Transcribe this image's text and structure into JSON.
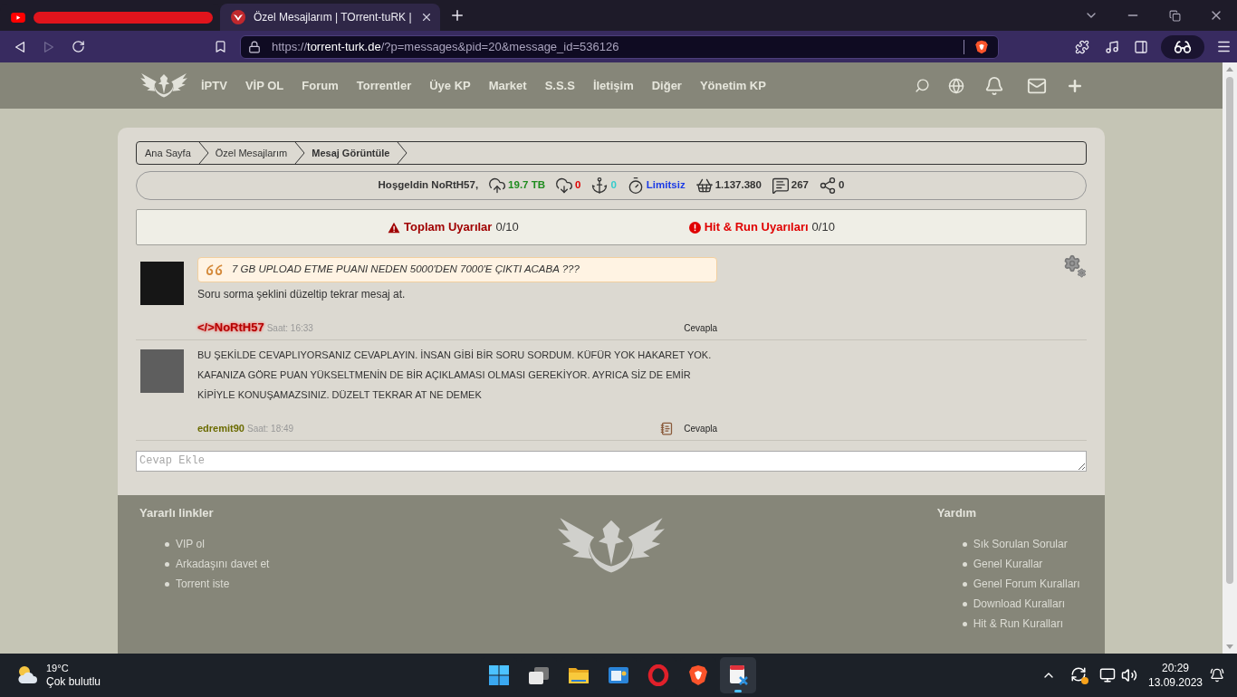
{
  "browser": {
    "tabs": [
      {
        "kind": "redacted",
        "selected": false
      },
      {
        "kind": "page",
        "title": "Özel Mesajlarım | TOrrent-tuRK |",
        "selected": true
      }
    ],
    "forward_button": {
      "disabled": true
    },
    "url": {
      "scheme": "https://",
      "host": "torrent-turk.de",
      "path": "/?p=messages&pid=20&message_id=536126"
    }
  },
  "nav": {
    "items": [
      "İPTV",
      "VİP OL",
      "Forum",
      "Torrentler",
      "Üye KP",
      "Market",
      "S.S.S",
      "İletişim",
      "Diğer",
      "Yönetim KP"
    ]
  },
  "breadcrumb": [
    {
      "label": "Ana Sayfa",
      "selected": false
    },
    {
      "label": "Özel Mesajlarım",
      "selected": false
    },
    {
      "label": "Mesaj Görüntüle",
      "selected": true
    }
  ],
  "stats": {
    "greeting": "Hoşgeldin NoRtH57,",
    "items": [
      {
        "kind": "upload",
        "value": "19.7 TB",
        "color": "#1e8c1e"
      },
      {
        "kind": "download",
        "value": "0",
        "color": "#e00000"
      },
      {
        "kind": "anchor",
        "value": "0",
        "color": "#33cccc"
      },
      {
        "kind": "timer",
        "value": "Limitsiz",
        "color": "#1a3ae6"
      },
      {
        "kind": "basket",
        "value": "1.137.380",
        "color": "#333333"
      },
      {
        "kind": "comments",
        "value": "267",
        "color": "#333333"
      },
      {
        "kind": "share",
        "value": "0",
        "color": "#333333"
      }
    ]
  },
  "warnings": [
    {
      "kind": "triangle",
      "label": "Toplam Uyarılar",
      "count": "0/10",
      "color": "#a00000"
    },
    {
      "kind": "circle",
      "label": "Hit & Run Uyarıları",
      "count": "0/10",
      "color": "#e00000"
    }
  ],
  "messages": [
    {
      "kind": "staff",
      "quote": "7 GB UPLOAD ETME PUANI NEDEN 5000'DEN 7000'E ÇIKTI ACABA ???",
      "lines": [
        "Soru sorma şeklini düzeltip tekrar mesaj at."
      ],
      "author": "</>NoRtH57",
      "time": "Saat: 16:33",
      "reply": "Cevapla"
    },
    {
      "kind": "member",
      "lines": [
        "BU ŞEKİLDE CEVAPLIYORSANIZ CEVAPLAYIN. İNSAN GİBİ BİR SORU SORDUM. KÜFÜR YOK HAKARET YOK.",
        "KAFANIZA GÖRE PUAN YÜKSELTMENİN DE BİR AÇIKLAMASI OLMASI GEREKİYOR. AYRICA SİZ DE EMİR",
        "KİPİYLE KONUŞAMAZSINIZ. DÜZELT TEKRAR AT NE DEMEK"
      ],
      "author": "edremit90",
      "time": "Saat: 18:49",
      "reply": "Cevapla"
    }
  ],
  "reply_field": {
    "placeholder": "Cevap Ekle"
  },
  "footer": {
    "columns": [
      {
        "title": "Yararlı linkler",
        "links": [
          "VIP ol",
          "Arkadaşını davet et",
          "Torrent iste"
        ]
      },
      {
        "title": "Yardım",
        "links": [
          "Sık Sorulan Sorular",
          "Genel Kurallar",
          "Genel Forum Kuralları",
          "Download Kuralları",
          "Hit & Run Kuralları"
        ]
      }
    ]
  },
  "taskbar": {
    "weather": {
      "temperature": "19°C",
      "condition": "Çok bulutlu"
    },
    "apps": [
      {
        "kind": "start",
        "selected": false
      },
      {
        "kind": "taskview",
        "selected": false
      },
      {
        "kind": "files",
        "selected": false
      },
      {
        "kind": "app",
        "selected": false
      },
      {
        "kind": "opera",
        "selected": false
      },
      {
        "kind": "brave",
        "selected": false
      },
      {
        "kind": "snip",
        "selected": true
      }
    ],
    "clock": {
      "time": "20:29",
      "date": "13.09.2023"
    }
  }
}
